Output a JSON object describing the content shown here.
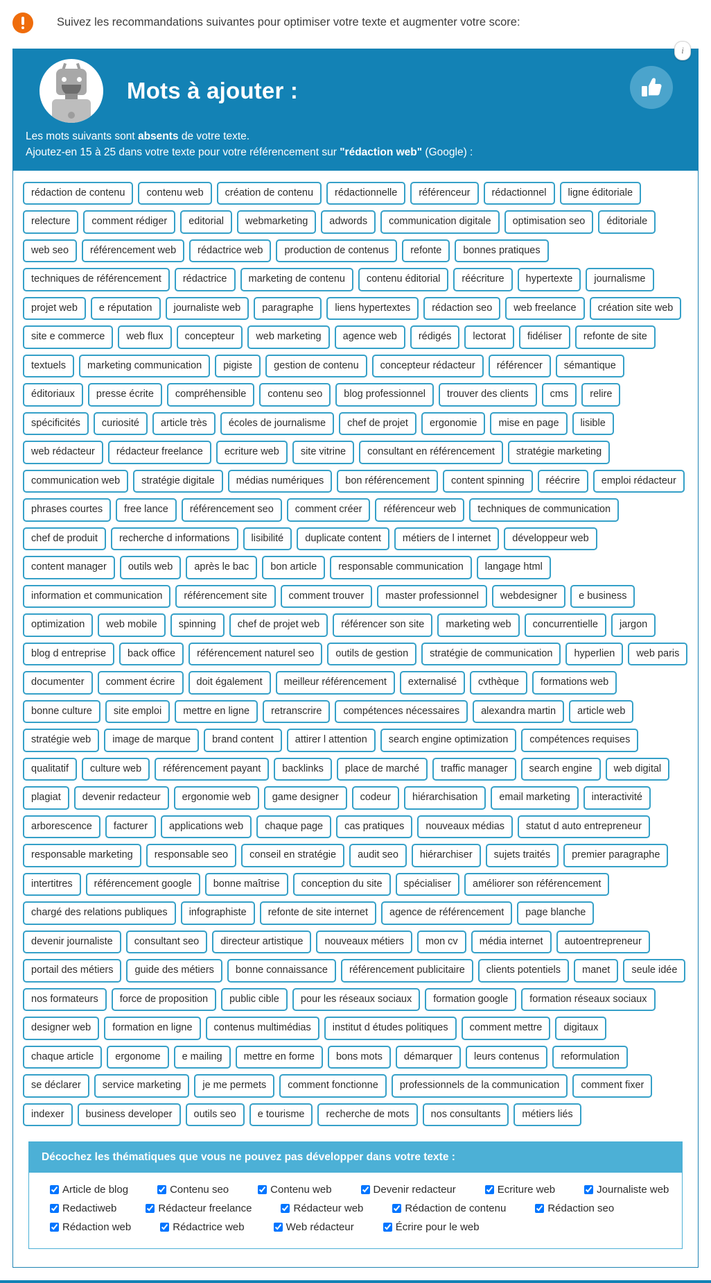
{
  "notice": {
    "icon": "alert-exclamation-icon",
    "text": "Suivez les recommandations suivantes pour optimiser votre texte et augmenter votre score:"
  },
  "card": {
    "info_badge": "i",
    "banner": {
      "title": "Mots à ajouter :",
      "avatar_icon": "robot-avatar-icon",
      "thumb_icon": "thumbs-up-icon",
      "line1_prefix": "Les mots suivants sont ",
      "line1_bold": "absents",
      "line1_suffix": " de votre texte.",
      "line2_prefix": "Ajoutez-en 15 à 25 dans votre texte pour votre référencement sur ",
      "line2_bold": "\"rédaction web\"",
      "line2_suffix": " (Google) :"
    },
    "colors": {
      "banner_blue": "#1382b5",
      "tag_border": "#35a0c8",
      "panel_blue": "#4cb0d6",
      "alert_orange": "#ef6c0b"
    },
    "tags": [
      "rédaction de contenu",
      "contenu web",
      "création de contenu",
      "rédactionnelle",
      "référenceur",
      "rédactionnel",
      "ligne éditoriale",
      "relecture",
      "comment rédiger",
      "editorial",
      "webmarketing",
      "adwords",
      "communication digitale",
      "optimisation seo",
      "éditoriale",
      "web seo",
      "référencement web",
      "rédactrice web",
      "production de contenus",
      "refonte",
      "bonnes pratiques",
      "techniques de référencement",
      "rédactrice",
      "marketing de contenu",
      "contenu éditorial",
      "réécriture",
      "hypertexte",
      "journalisme",
      "projet web",
      "e réputation",
      "journaliste web",
      "paragraphe",
      "liens hypertextes",
      "rédaction seo",
      "web freelance",
      "création site web",
      "site e commerce",
      "web flux",
      "concepteur",
      "web marketing",
      "agence web",
      "rédigés",
      "lectorat",
      "fidéliser",
      "refonte de site",
      "textuels",
      "marketing communication",
      "pigiste",
      "gestion de contenu",
      "concepteur rédacteur",
      "référencer",
      "sémantique",
      "éditoriaux",
      "presse écrite",
      "compréhensible",
      "contenu seo",
      "blog professionnel",
      "trouver des clients",
      "cms",
      "relire",
      "spécificités",
      "curiosité",
      "article très",
      "écoles de journalisme",
      "chef de projet",
      "ergonomie",
      "mise en page",
      "lisible",
      "web rédacteur",
      "rédacteur freelance",
      "ecriture web",
      "site vitrine",
      "consultant en référencement",
      "stratégie marketing",
      "communication web",
      "stratégie digitale",
      "médias numériques",
      "bon référencement",
      "content spinning",
      "réécrire",
      "emploi rédacteur",
      "phrases courtes",
      "free lance",
      "référencement seo",
      "comment créer",
      "référenceur web",
      "techniques de communication",
      "chef de produit",
      "recherche d informations",
      "lisibilité",
      "duplicate content",
      "métiers de l internet",
      "développeur web",
      "content manager",
      "outils web",
      "après le bac",
      "bon article",
      "responsable communication",
      "langage html",
      "information et communication",
      "référencement site",
      "comment trouver",
      "master professionnel",
      "webdesigner",
      "e business",
      "optimization",
      "web mobile",
      "spinning",
      "chef de projet web",
      "référencer son site",
      "marketing web",
      "concurrentielle",
      "jargon",
      "blog d entreprise",
      "back office",
      "référencement naturel seo",
      "outils de gestion",
      "stratégie de communication",
      "hyperlien",
      "web paris",
      "documenter",
      "comment écrire",
      "doit également",
      "meilleur référencement",
      "externalisé",
      "cvthèque",
      "formations web",
      "bonne culture",
      "site emploi",
      "mettre en ligne",
      "retranscrire",
      "compétences nécessaires",
      "alexandra martin",
      "article web",
      "stratégie web",
      "image de marque",
      "brand content",
      "attirer l attention",
      "search engine optimization",
      "compétences requises",
      "qualitatif",
      "culture web",
      "référencement payant",
      "backlinks",
      "place de marché",
      "traffic manager",
      "search engine",
      "web digital",
      "plagiat",
      "devenir redacteur",
      "ergonomie web",
      "game designer",
      "codeur",
      "hiérarchisation",
      "email marketing",
      "interactivité",
      "arborescence",
      "facturer",
      "applications web",
      "chaque page",
      "cas pratiques",
      "nouveaux médias",
      "statut d auto entrepreneur",
      "responsable marketing",
      "responsable seo",
      "conseil en stratégie",
      "audit seo",
      "hiérarchiser",
      "sujets traités",
      "premier paragraphe",
      "intertitres",
      "référencement google",
      "bonne maîtrise",
      "conception du site",
      "spécialiser",
      "améliorer son référencement",
      "chargé des relations publiques",
      "infographiste",
      "refonte de site internet",
      "agence de référencement",
      "page blanche",
      "devenir journaliste",
      "consultant seo",
      "directeur artistique",
      "nouveaux métiers",
      "mon cv",
      "média internet",
      "autoentrepreneur",
      "portail des métiers",
      "guide des métiers",
      "bonne connaissance",
      "référencement publicitaire",
      "clients potentiels",
      "manet",
      "seule idée",
      "nos formateurs",
      "force de proposition",
      "public cible",
      "pour les réseaux sociaux",
      "formation google",
      "formation réseaux sociaux",
      "designer web",
      "formation en ligne",
      "contenus multimédias",
      "institut d études politiques",
      "comment mettre",
      "digitaux",
      "chaque article",
      "ergonome",
      "e mailing",
      "mettre en forme",
      "bons mots",
      "démarquer",
      "leurs contenus",
      "reformulation",
      "se déclarer",
      "service marketing",
      "je me permets",
      "comment fonctionne",
      "professionnels de la communication",
      "comment fixer",
      "indexer",
      "business developer",
      "outils seo",
      "e tourisme",
      "recherche de mots",
      "nos consultants",
      "métiers liés"
    ],
    "themes": {
      "heading": "Décochez les thématiques que vous ne pouvez pas développer dans votre texte :",
      "items": [
        {
          "label": "Article de blog",
          "checked": true
        },
        {
          "label": "Contenu seo",
          "checked": true
        },
        {
          "label": "Contenu web",
          "checked": true
        },
        {
          "label": "Devenir redacteur",
          "checked": true
        },
        {
          "label": "Ecriture web",
          "checked": true
        },
        {
          "label": "Journaliste web",
          "checked": true
        },
        {
          "label": "Redactiweb",
          "checked": true
        },
        {
          "label": "Rédacteur freelance",
          "checked": true
        },
        {
          "label": "Rédacteur web",
          "checked": true
        },
        {
          "label": "Rédaction de contenu",
          "checked": true
        },
        {
          "label": "Rédaction seo",
          "checked": true
        },
        {
          "label": "Rédaction web",
          "checked": true
        },
        {
          "label": "Rédactrice web",
          "checked": true
        },
        {
          "label": "Web rédacteur",
          "checked": true
        },
        {
          "label": "Écrire pour le web",
          "checked": true
        }
      ]
    }
  }
}
